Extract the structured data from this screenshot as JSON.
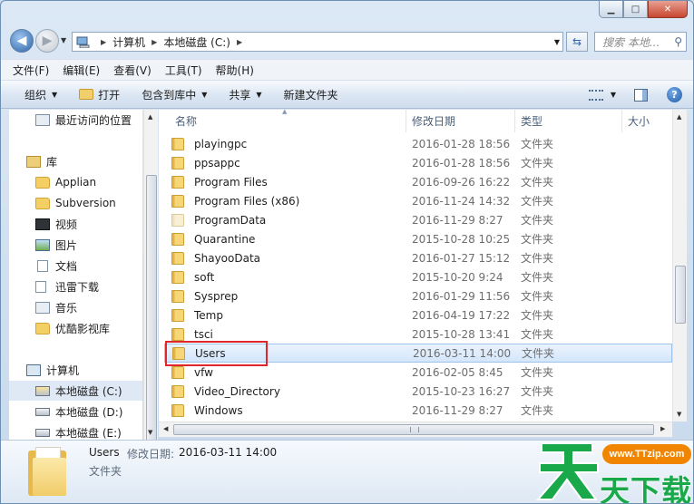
{
  "window": {
    "caption": {
      "minimize": "▁",
      "maximize": "□",
      "close": "✕"
    }
  },
  "address": {
    "back_icon": "◀",
    "forward_icon": "▶",
    "crumbs": [
      "计算机",
      "本地磁盘 (C:)"
    ],
    "search_placeholder": "搜索 本地..."
  },
  "menubar": [
    "文件(F)",
    "编辑(E)",
    "查看(V)",
    "工具(T)",
    "帮助(H)"
  ],
  "toolbar": {
    "organize": "组织",
    "open": "打开",
    "include_library": "包含到库中",
    "share": "共享",
    "new_folder": "新建文件夹"
  },
  "navpane": {
    "recent": "最近访问的位置",
    "library": "库",
    "lib_items": [
      "Applian",
      "Subversion",
      "视频",
      "图片",
      "文档",
      "迅雷下载",
      "音乐",
      "优酷影视库"
    ],
    "computer": "计算机",
    "drives": [
      "本地磁盘 (C:)",
      "本地磁盘 (D:)",
      "本地磁盘 (E:)"
    ],
    "selected_drive": "本地磁盘 (C:)"
  },
  "filelist": {
    "columns": [
      "名称",
      "修改日期",
      "类型",
      "大小"
    ],
    "rows": [
      {
        "name": "playingpc",
        "date": "2016-01-28 18:56",
        "type": "文件夹"
      },
      {
        "name": "ppsappc",
        "date": "2016-01-28 18:56",
        "type": "文件夹"
      },
      {
        "name": "Program Files",
        "date": "2016-09-26 16:22",
        "type": "文件夹"
      },
      {
        "name": "Program Files (x86)",
        "date": "2016-11-24 14:32",
        "type": "文件夹"
      },
      {
        "name": "ProgramData",
        "date": "2016-11-29 8:27",
        "type": "文件夹"
      },
      {
        "name": "Quarantine",
        "date": "2015-10-28 10:25",
        "type": "文件夹"
      },
      {
        "name": "ShayooData",
        "date": "2016-01-27 15:12",
        "type": "文件夹"
      },
      {
        "name": "soft",
        "date": "2015-10-20 9:24",
        "type": "文件夹"
      },
      {
        "name": "Sysprep",
        "date": "2016-01-29 11:56",
        "type": "文件夹"
      },
      {
        "name": "Temp",
        "date": "2016-04-19 17:22",
        "type": "文件夹"
      },
      {
        "name": "tsci",
        "date": "2015-10-28 13:41",
        "type": "文件夹"
      },
      {
        "name": "Users",
        "date": "2016-03-11 14:00",
        "type": "文件夹"
      },
      {
        "name": "vfw",
        "date": "2016-02-05 8:45",
        "type": "文件夹"
      },
      {
        "name": "Video_Directory",
        "date": "2015-10-23 16:27",
        "type": "文件夹"
      },
      {
        "name": "Windows",
        "date": "2016-11-29 8:27",
        "type": "文件夹"
      }
    ],
    "selected": "Users"
  },
  "details": {
    "name": "Users",
    "date_label": "修改日期:",
    "date": "2016-03-11 14:00",
    "type": "文件夹"
  },
  "watermark": {
    "url": "www.TTzip.com",
    "text": "天下载"
  },
  "colors": {
    "selection": "#d4e6fb",
    "highlight": "#e0262b",
    "watermark_green": "#1aa94a",
    "watermark_orange": "#f28500"
  }
}
